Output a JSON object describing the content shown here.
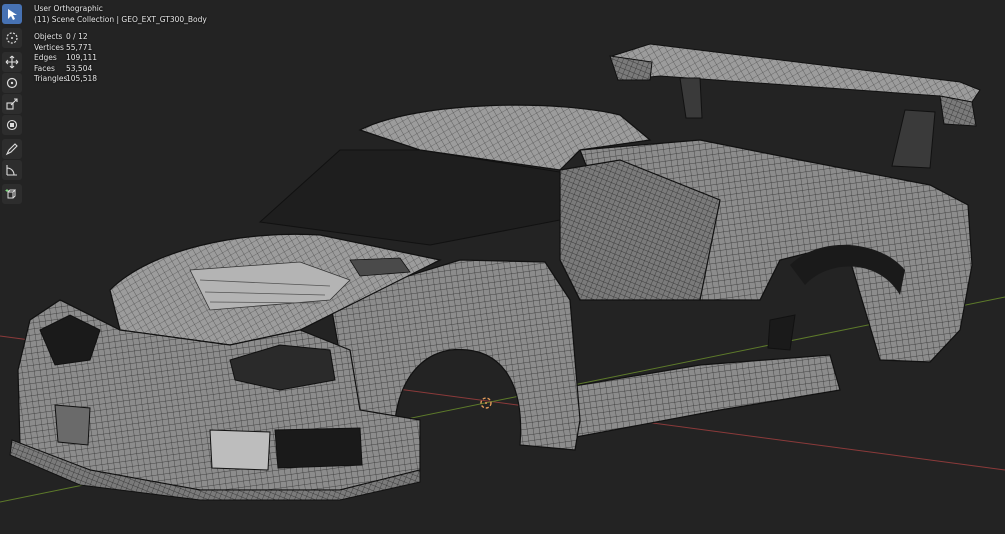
{
  "viewport": {
    "view_name": "User Orthographic",
    "collection_line": "(11) Scene Collection | GEO_EXT_GT300_Body"
  },
  "stats": [
    {
      "label": "Objects",
      "value": "0 / 12"
    },
    {
      "label": "Vertices",
      "value": "55,771"
    },
    {
      "label": "Edges",
      "value": "109,111"
    },
    {
      "label": "Faces",
      "value": "53,504"
    },
    {
      "label": "Triangles",
      "value": "105,518"
    }
  ],
  "toolbar": [
    {
      "name": "select-box-tool",
      "icon": "cursor-select-icon",
      "active": true
    },
    {
      "name": "cursor-tool",
      "icon": "3d-cursor-icon",
      "active": false
    },
    {
      "name": "move-tool",
      "icon": "move-arrows-icon",
      "active": false
    },
    {
      "name": "rotate-tool",
      "icon": "rotate-icon",
      "active": false
    },
    {
      "name": "scale-tool",
      "icon": "scale-icon",
      "active": false
    },
    {
      "name": "transform-tool",
      "icon": "transform-icon",
      "active": false
    },
    {
      "name": "annotate-tool",
      "icon": "annotate-pencil-icon",
      "active": false
    },
    {
      "name": "measure-tool",
      "icon": "measure-ruler-icon",
      "active": false
    },
    {
      "name": "add-cube-tool",
      "icon": "add-cube-icon",
      "active": false
    }
  ],
  "colors": {
    "background": "#232323",
    "mesh_fill": "#8a8a8a",
    "wire": "#2a2a2a",
    "x_axis": "#8b3a3a",
    "y_axis": "#5d7a2a",
    "cursor": "#e39b5a",
    "active_tool": "#4772b3"
  }
}
